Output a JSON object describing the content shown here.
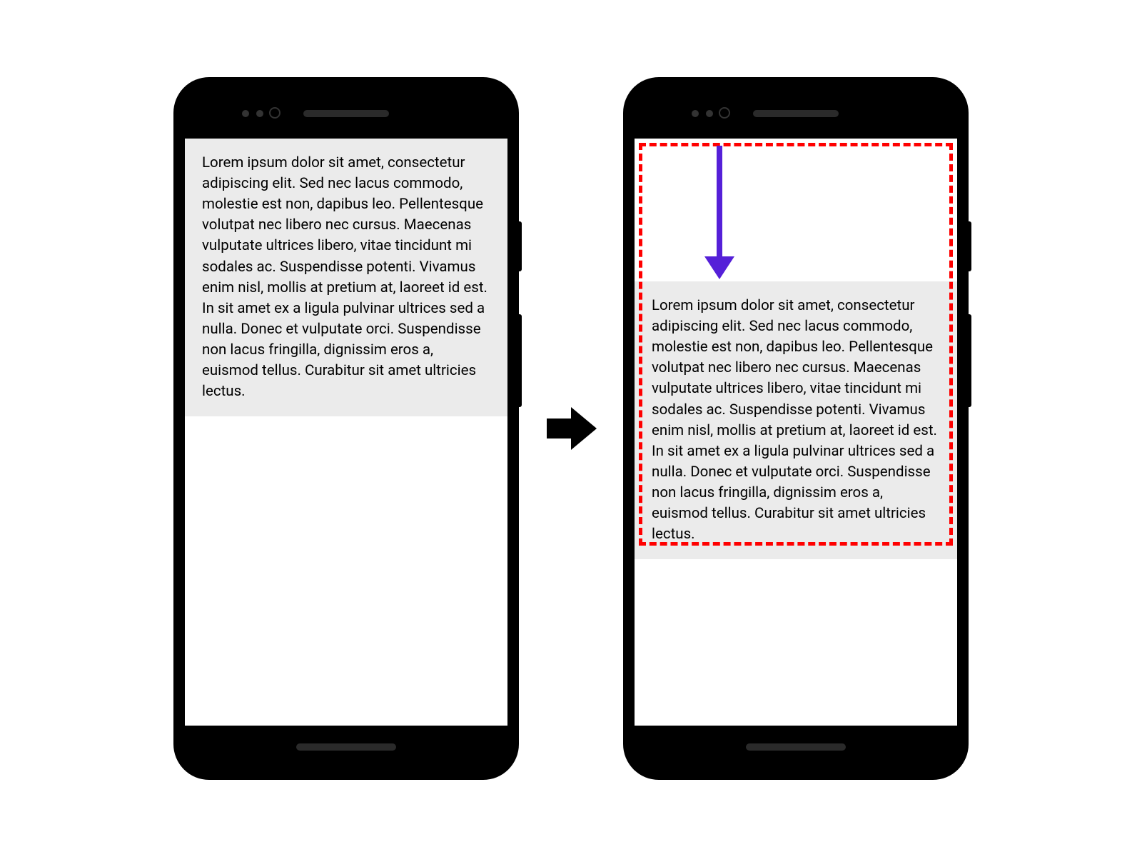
{
  "diagram": {
    "lorem_text": "Lorem ipsum dolor sit amet, consectetur adipiscing elit. Sed nec lacus commodo, molestie est non, dapibus leo. Pellentesque volutpat nec libero nec cursus. Maecenas vulputate ultrices libero, vitae tincidunt mi sodales ac. Suspendisse potenti. Vivamus enim nisl, mollis at pretium at, laoreet id est. In sit amet ex a ligula pulvinar ultrices sed a nulla. Donec et vulputate orci. Suspendisse non lacus fringilla, dignissim eros a, euismod tellus. Curabitur sit amet ultricies lectus."
  }
}
